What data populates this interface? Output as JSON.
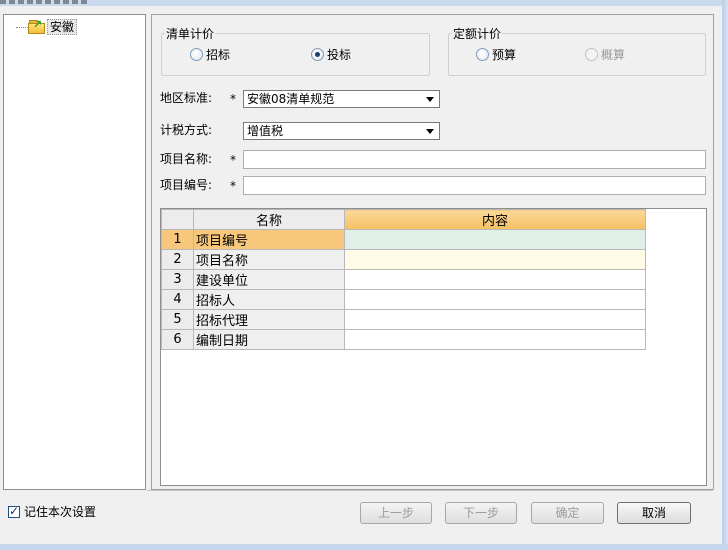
{
  "tree": {
    "root_label": "安徽"
  },
  "pricing_group": {
    "legend": "清单计价",
    "options": [
      {
        "label": "招标",
        "selected": false
      },
      {
        "label": "投标",
        "selected": true
      }
    ]
  },
  "quota_group": {
    "legend": "定额计价",
    "options": [
      {
        "label": "预算",
        "selected": false,
        "enabled": true
      },
      {
        "label": "概算",
        "selected": false,
        "enabled": false
      }
    ]
  },
  "form": {
    "region_label": "地区标准:",
    "region_value": "安徽08清单规范",
    "tax_label": "计税方式:",
    "tax_value": "增值税",
    "project_name_label": "项目名称:",
    "project_name_value": "",
    "project_code_label": "项目编号:",
    "project_code_value": "",
    "required_mark": "*"
  },
  "grid": {
    "headers": [
      "名称",
      "内容"
    ],
    "rows": [
      {
        "num": "1",
        "name": "项目编号",
        "content": ""
      },
      {
        "num": "2",
        "name": "项目名称",
        "content": ""
      },
      {
        "num": "3",
        "name": "建设单位",
        "content": ""
      },
      {
        "num": "4",
        "name": "招标人",
        "content": ""
      },
      {
        "num": "5",
        "name": "招标代理",
        "content": ""
      },
      {
        "num": "6",
        "name": "编制日期",
        "content": ""
      }
    ]
  },
  "footer": {
    "remember_label": "记住本次设置",
    "remember_checked": true,
    "prev_label": "上一步",
    "next_label": "下一步",
    "ok_label": "确定",
    "cancel_label": "取消"
  },
  "colors": {
    "selected_row": "#f7c77c",
    "active_header": "#f5c061",
    "focused_cell": "#e0efe8",
    "row2_content": "#fffbe6"
  }
}
